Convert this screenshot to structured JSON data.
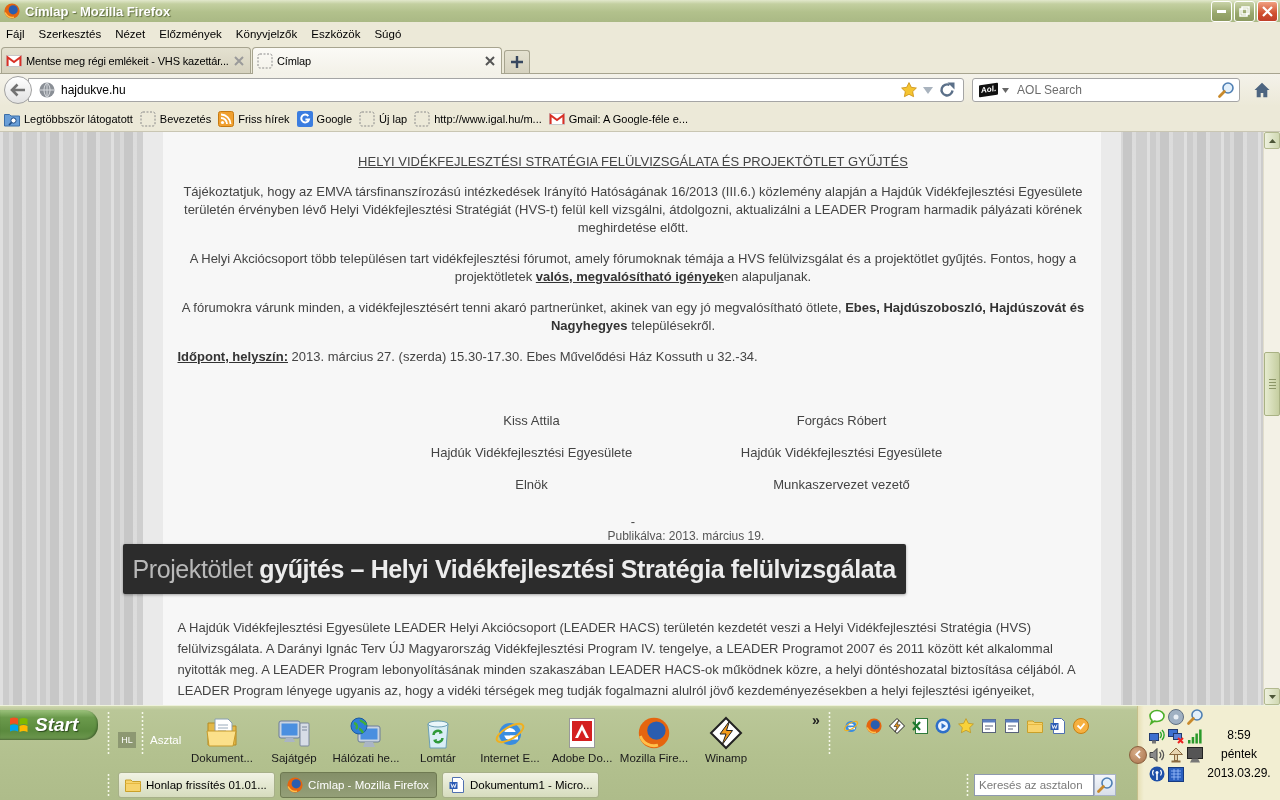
{
  "window": {
    "title": "Címlap - Mozilla Firefox"
  },
  "menu": [
    "Fájl",
    "Szerkesztés",
    "Nézet",
    "Előzmények",
    "Könyvjelzők",
    "Eszközök",
    "Súgó"
  ],
  "tabs": [
    {
      "label": "Mentse meg régi emlékeit - VHS kazettár...",
      "kind": "mail",
      "selected": false
    },
    {
      "label": "Címlap",
      "kind": "blank",
      "selected": true
    }
  ],
  "address_bar": {
    "value": "hajdukve.hu"
  },
  "search_bar": {
    "engine_logo": "Aol.",
    "placeholder": "AOL Search"
  },
  "bookmarks": [
    {
      "label": "Legtöbbször látogatott",
      "kind": "smart-folder"
    },
    {
      "label": "Bevezetés",
      "kind": "blank"
    },
    {
      "label": "Friss hírek",
      "kind": "feed"
    },
    {
      "label": "Google",
      "kind": "tile"
    },
    {
      "label": "Új lap",
      "kind": "blank"
    },
    {
      "label": "http://www.igal.hu/m...",
      "kind": "blank"
    },
    {
      "label": "Gmail: A Google-féle e...",
      "kind": "mail"
    }
  ],
  "page": {
    "heading": "HELYI VIDÉKFEJLESZTÉSI STRATÉGIA FELÜLVIZSGÁLATA ÉS PROJEKTÖTLET GYŰJTÉS",
    "paragraphs": [
      {
        "text": "Tájékoztatjuk, hogy az EMVA társfinanszírozású intézkedések Irányító Hatóságának 16/2013 (III.6.) közlemény alapján a Hajdúk Vidékfejlesztési Egyesülete területén érvényben lévő Helyi Vidékfejlesztési Stratégiát (HVS-t) felül kell vizsgálni, átdolgozni, aktualizálni a LEADER Program harmadik pályázati körének meghirdetése előtt.",
        "centered": true
      },
      {
        "text": "A Helyi Akciócsoport több településen tart vidékfejlesztési fórumot, amely fórumoknak témája a HVS felülvizsgálat és a projektötlet gyűjtés. Fontos, hogy a projektötletek **valós, megvalósítható igények**en alapuljanak.",
        "centered": true,
        "bold_underlined": true
      },
      {
        "text": "A fórumokra várunk minden, a vidékfejlesztésért tenni akaró partnerünket, akinek van egy jó megvalósítható ötlete, **Ebes, Hajdúszoboszló, Hajdúszovát és Nagyhegyes** településekről.",
        "centered": true,
        "bold_underlined": false
      },
      {
        "text": "**Időpont, helyszín:** 2013. március 27. (szerda) 15.30-17.30. Ebes Művelődési Ház Kossuth u 32.-34.",
        "centered": false,
        "bold_underlined": true
      }
    ],
    "signatures": [
      {
        "name": "Kiss Attila",
        "organization": "Hajdúk Vidékfejlesztési Egyesülete",
        "role": "Elnök"
      },
      {
        "name": "Forgács Róbert",
        "organization": "Hajdúk Vidékfejlesztési Egyesülete",
        "role": "Munkaszervezet vezető"
      }
    ],
    "separator": "-",
    "published": "Publikálva: 2013. március 19."
  },
  "post": {
    "title": "Projektötlet **gyűjtés – Helyi Vidékfejlesztési Stratégia felülvizsgálata**",
    "body": "A Hajdúk Vidékfejlesztési Egyesülete LEADER Helyi Akciócsoport (LEADER HACS) területén kezdetét veszi a Helyi Vidékfejlesztési Stratégia (HVS) felülvizsgálata. A Darányi Ignác Terv ÚJ Magyarország Vidékfejlesztési Program IV. tengelye, a LEADER Programot 2007 és 2011 között két alkalommal nyitották meg. A LEADER Program lebonyolításának minden szakaszában LEADER HACS-ok működnek közre, a helyi döntéshozatal biztosítása céljából. A LEADER Program lényege ugyanis az, hogy a vidéki térségek meg tudják fogalmazni alulról jövő kezdeményezésekben a helyi fejlesztési igényeiket,"
  },
  "taskbar": {
    "start": "Start",
    "collapsed_toolbar": "HL",
    "toolbar_title": "Asztal",
    "shortcuts": [
      {
        "label": "Dokument...",
        "kind": "documents"
      },
      {
        "label": "Sajátgép",
        "kind": "computer"
      },
      {
        "label": "Hálózati he...",
        "kind": "network"
      },
      {
        "label": "Lomtár",
        "kind": "recycle-bin"
      },
      {
        "label": "Internet E...",
        "kind": "browser-e"
      },
      {
        "label": "Adobe Do...",
        "kind": "pdf"
      },
      {
        "label": "Mozilla Fire...",
        "kind": "browser-fox"
      },
      {
        "label": "Winamp",
        "kind": "player"
      }
    ],
    "overflow": "»",
    "windows": [
      {
        "label": "Honlap frissítés 01.01...",
        "kind": "folder",
        "selected": false
      },
      {
        "label": "Címlap - Mozilla Firefox",
        "kind": "browser-fox",
        "selected": true
      },
      {
        "label": "Dokumentum1 - Micro...",
        "kind": "document",
        "selected": false
      }
    ],
    "search": {
      "placeholder": "Keresés az asztalon"
    }
  },
  "clock": {
    "time": "8:59",
    "day": "péntek",
    "date": "2013.03.29."
  }
}
